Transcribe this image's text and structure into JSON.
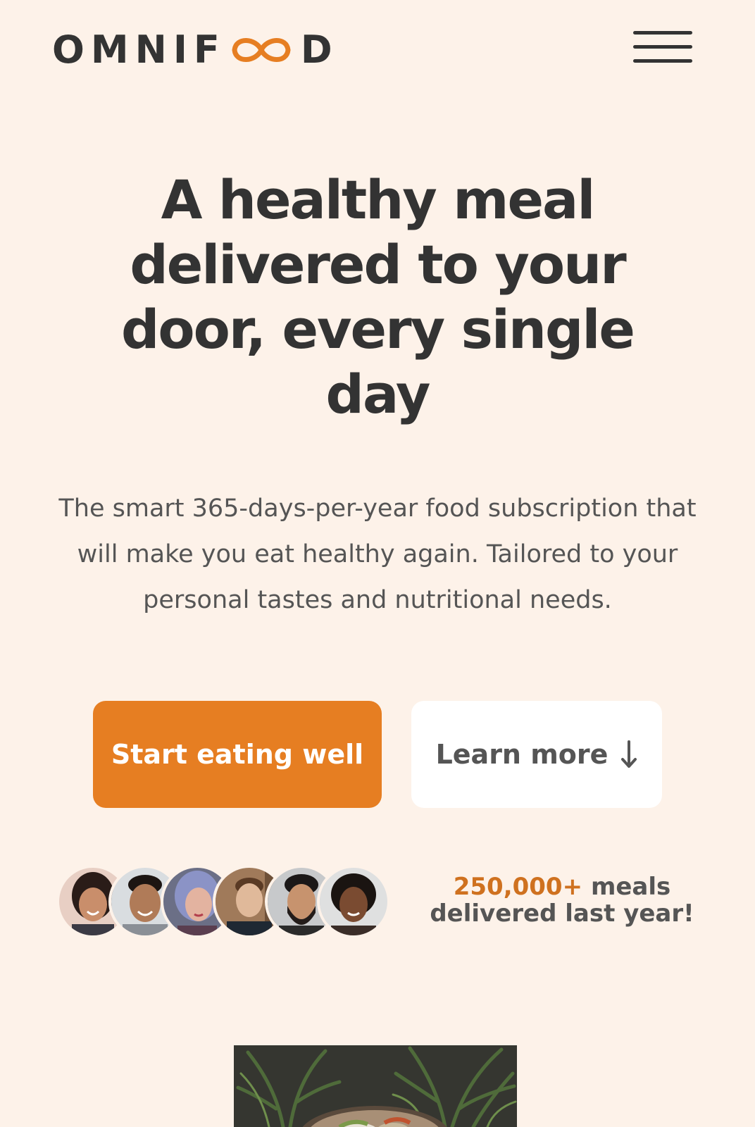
{
  "header": {
    "logo_left": "OMNIF",
    "logo_right": "D",
    "logo_icon": "infinity-icon",
    "menu_icon": "hamburger-menu-icon"
  },
  "hero": {
    "title": "A healthy meal delivered to your door, every single day",
    "description": "The smart 365-days-per-year food subscription that will make you eat healthy again. Tailored to your personal tastes and nutritional needs.",
    "primary_cta": "Start eating well",
    "secondary_cta": "Learn more",
    "secondary_cta_icon": "arrow-down-icon"
  },
  "delivered": {
    "count": "250,000+",
    "text_part1": "meals",
    "text_part2": "delivered last year!",
    "avatars": [
      "customer-1",
      "customer-2",
      "customer-3",
      "customer-4",
      "customer-5",
      "customer-6"
    ]
  },
  "hero_image": {
    "subject": "food-bowl-image"
  },
  "colors": {
    "background": "#fdf2e9",
    "accent": "#e67e22",
    "accent_dark": "#cf711f",
    "text_dark": "#333333",
    "text_muted": "#555555"
  }
}
